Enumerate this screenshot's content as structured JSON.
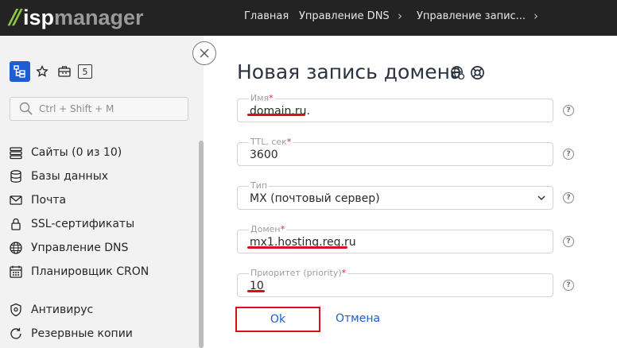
{
  "brand": {
    "slashes": "//",
    "part1": "isp",
    "part2": "manager",
    "accent": "#8ec63f"
  },
  "breadcrumbs": [
    "Главная",
    "Управление DNS",
    "Управление запис..."
  ],
  "sidebar": {
    "badge": "5",
    "search_placeholder": "Ctrl + Shift + M",
    "items": [
      {
        "label": "Сайты (0 из 10)",
        "icon": "sites-icon"
      },
      {
        "label": "Базы данных",
        "icon": "database-icon"
      },
      {
        "label": "Почта",
        "icon": "mail-icon"
      },
      {
        "label": "SSL-сертификаты",
        "icon": "lock-icon"
      },
      {
        "label": "Управление DNS",
        "icon": "globe-icon"
      },
      {
        "label": "Планировщик CRON",
        "icon": "calendar-icon"
      },
      {
        "label": "Антивирус",
        "icon": "shield-icon"
      },
      {
        "label": "Резервные копии",
        "icon": "backup-icon"
      }
    ]
  },
  "form": {
    "title": "Новая запись домена",
    "fields": {
      "name": {
        "label": "Имя",
        "value": "domain.ru."
      },
      "ttl": {
        "label": "TTL, сек",
        "value": "3600"
      },
      "type": {
        "label": "Тип",
        "value": "MX (почтовый сервер)"
      },
      "domain": {
        "label": "Домен",
        "value": "mx1.hosting.reg.ru"
      },
      "priority": {
        "label": "Приоритет (priority)",
        "value": "10"
      }
    },
    "required_mark": "*",
    "help_mark": "?",
    "ok_label": "Ok",
    "cancel_label": "Отмена"
  },
  "colors": {
    "primary": "#1f5bd1",
    "highlight": "#d7111b",
    "topbar": "#232323"
  }
}
